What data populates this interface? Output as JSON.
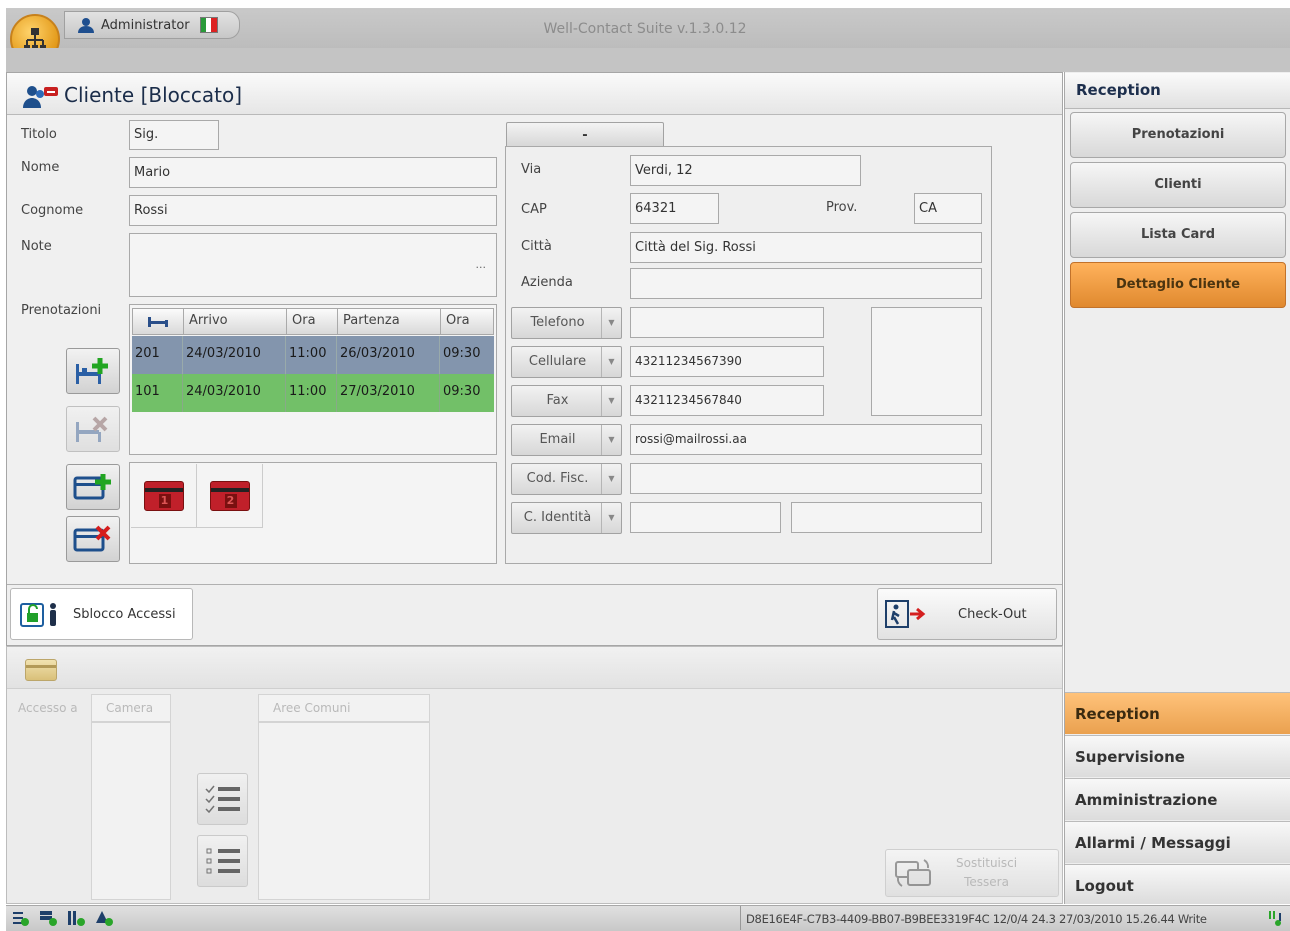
{
  "titlebar": {
    "user": "Administrator",
    "app_title": "Well-Contact Suite v.1.3.0.12"
  },
  "form": {
    "title": "Cliente [Bloccato]",
    "labels": {
      "titolo": "Titolo",
      "nome": "Nome",
      "cognome": "Cognome",
      "note": "Note",
      "prenotazioni": "Prenotazioni"
    },
    "values": {
      "titolo": "Sig.",
      "nome": "Mario",
      "cognome": "Rossi",
      "note_ellipsis": "..."
    },
    "bookings_table": {
      "headers": [
        "Arrivo",
        "Ora",
        "Partenza",
        "Ora"
      ],
      "rows": [
        {
          "room": "201",
          "arrivo": "24/03/2010",
          "ora1": "11:00",
          "partenza": "26/03/2010",
          "ora2": "09:30"
        },
        {
          "room": "101",
          "arrivo": "24/03/2010",
          "ora1": "11:00",
          "partenza": "27/03/2010",
          "ora2": "09:30"
        }
      ]
    },
    "cards": [
      "1",
      "2"
    ]
  },
  "address": {
    "tab_label": "-",
    "labels": {
      "via": "Via",
      "cap": "CAP",
      "prov": "Prov.",
      "citta": "Città",
      "azienda": "Azienda"
    },
    "values": {
      "via": "Verdi, 12",
      "cap": "64321",
      "prov": "CA",
      "citta": "Città del Sig. Rossi",
      "azienda": ""
    },
    "contacts": [
      {
        "label": "Telefono",
        "value": ""
      },
      {
        "label": "Cellulare",
        "value": "43211234567390"
      },
      {
        "label": "Fax",
        "value": "43211234567840"
      },
      {
        "label": "Email",
        "value": "rossi@mailrossi.aa"
      },
      {
        "label": "Cod. Fisc.",
        "value": ""
      },
      {
        "label": "C. Identità",
        "value": ""
      }
    ]
  },
  "actions": {
    "sblocco": "Sblocco Accessi",
    "checkout": "Check-Out"
  },
  "access": {
    "accesso_a": "Accesso a",
    "camera": "Camera",
    "aree_comuni": "Aree Comuni",
    "sostituisci_1": "Sostituisci",
    "sostituisci_2": "Tessera"
  },
  "sidebar": {
    "header": "Reception",
    "items": [
      "Prenotazioni",
      "Clienti",
      "Lista Card",
      "Dettaglio Cliente"
    ],
    "active_item": "Dettaglio Cliente",
    "sections": [
      "Reception",
      "Supervisione",
      "Amministrazione",
      "Allarmi / Messaggi",
      "Logout"
    ]
  },
  "statusbar": {
    "text": "D8E16E4F-C7B3-4409-BB07-B9BEE3319F4C 12/0/4 24.3 27/03/2010 15.26.44 Write"
  },
  "colors": {
    "orange": "#f0962f",
    "row_selected": "#7f8fa8",
    "row_green": "#6fbf62",
    "card_red": "#c0202a"
  }
}
